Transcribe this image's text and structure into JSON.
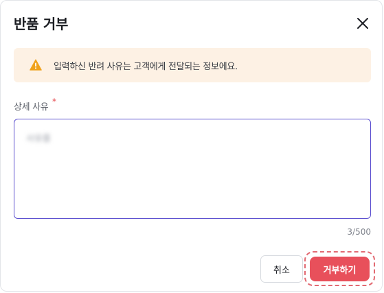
{
  "dialog": {
    "title": "반품 거부",
    "close_icon": "close-icon"
  },
  "notice": {
    "icon": "warning-icon",
    "icon_color": "#f0a21c",
    "background": "#fdf1e4",
    "message": "입력하신 반려 사유는 고객에게 전달되는 정보에요."
  },
  "reason_field": {
    "label": "상세 사유",
    "required_mark": "*",
    "value": "사유를",
    "char_count": "3/500"
  },
  "actions": {
    "cancel_label": "취소",
    "reject_label": "거부하기",
    "reject_color": "#e8505b"
  }
}
